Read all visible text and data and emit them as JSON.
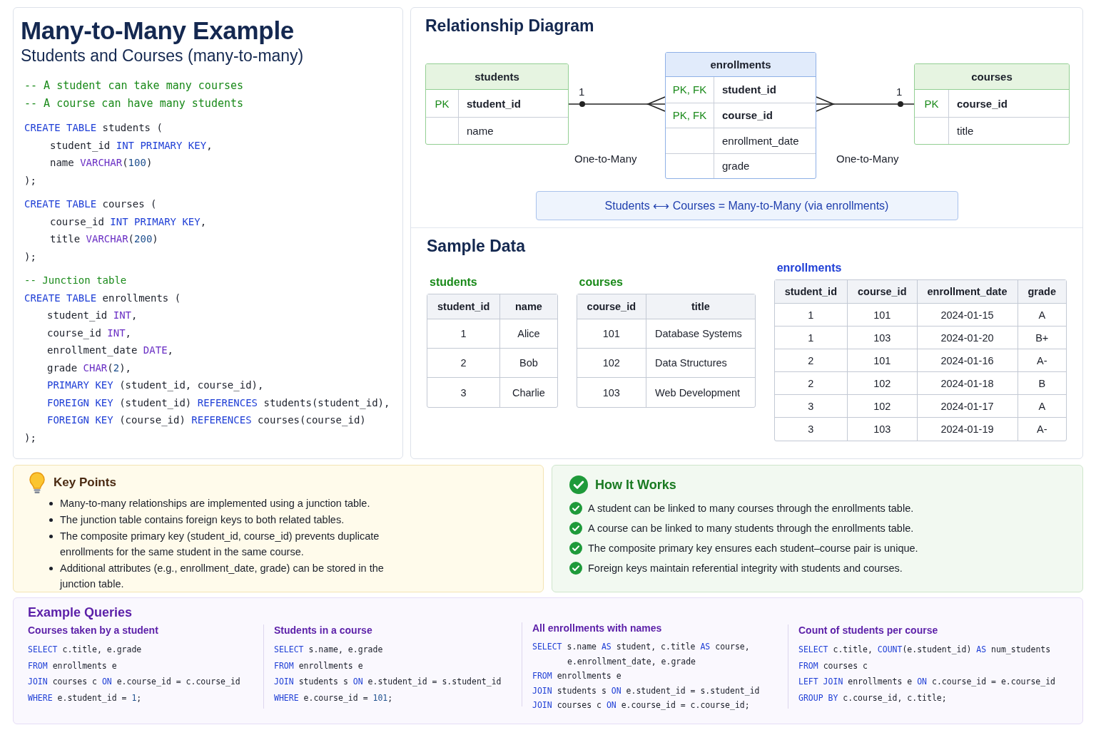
{
  "header": {
    "title": "Many-to-Many Example",
    "subtitle": "Students and Courses (many-to-many)"
  },
  "schema_code": {
    "blocks": [
      [
        {
          "tokens": [
            {
              "kind": "comment",
              "text": "-- A student can take many courses"
            }
          ]
        },
        {
          "tokens": [
            {
              "kind": "comment",
              "text": "-- A course can have many students"
            }
          ]
        }
      ],
      [
        {
          "tokens": [
            {
              "kind": "kw",
              "text": "CREATE TABLE"
            },
            {
              "kind": "plain",
              "text": " students ("
            }
          ]
        },
        {
          "indent": true,
          "tokens": [
            {
              "kind": "plain",
              "text": "student_id "
            },
            {
              "kind": "kw",
              "text": "INT PRIMARY KEY"
            },
            {
              "kind": "plain",
              "text": ","
            }
          ]
        },
        {
          "indent": true,
          "tokens": [
            {
              "kind": "plain",
              "text": "name "
            },
            {
              "kind": "type",
              "text": "VARCHAR"
            },
            {
              "kind": "plain",
              "text": "("
            },
            {
              "kind": "num",
              "text": "100"
            },
            {
              "kind": "plain",
              "text": ")"
            }
          ]
        },
        {
          "tokens": [
            {
              "kind": "plain",
              "text": ");"
            }
          ]
        }
      ],
      [
        {
          "tokens": [
            {
              "kind": "kw",
              "text": "CREATE TABLE"
            },
            {
              "kind": "plain",
              "text": " courses ("
            }
          ]
        },
        {
          "indent": true,
          "tokens": [
            {
              "kind": "plain",
              "text": "course_id "
            },
            {
              "kind": "kw",
              "text": "INT PRIMARY KEY"
            },
            {
              "kind": "plain",
              "text": ","
            }
          ]
        },
        {
          "indent": true,
          "tokens": [
            {
              "kind": "plain",
              "text": "title "
            },
            {
              "kind": "type",
              "text": "VARCHAR"
            },
            {
              "kind": "plain",
              "text": "("
            },
            {
              "kind": "num",
              "text": "200"
            },
            {
              "kind": "plain",
              "text": ")"
            }
          ]
        },
        {
          "tokens": [
            {
              "kind": "plain",
              "text": ");"
            }
          ]
        }
      ],
      [
        {
          "tokens": [
            {
              "kind": "comment",
              "text": "-- Junction table"
            }
          ]
        },
        {
          "tokens": [
            {
              "kind": "kw",
              "text": "CREATE TABLE"
            },
            {
              "kind": "plain",
              "text": " enrollments ("
            }
          ]
        },
        {
          "indent": true,
          "tokens": [
            {
              "kind": "plain",
              "text": "student_id "
            },
            {
              "kind": "type",
              "text": "INT"
            },
            {
              "kind": "plain",
              "text": ","
            }
          ]
        },
        {
          "indent": true,
          "tokens": [
            {
              "kind": "plain",
              "text": "course_id "
            },
            {
              "kind": "type",
              "text": "INT"
            },
            {
              "kind": "plain",
              "text": ","
            }
          ]
        },
        {
          "indent": true,
          "tokens": [
            {
              "kind": "plain",
              "text": "enrollment_date "
            },
            {
              "kind": "type",
              "text": "DATE"
            },
            {
              "kind": "plain",
              "text": ","
            }
          ]
        },
        {
          "indent": true,
          "tokens": [
            {
              "kind": "plain",
              "text": "grade "
            },
            {
              "kind": "type",
              "text": "CHAR"
            },
            {
              "kind": "plain",
              "text": "("
            },
            {
              "kind": "num",
              "text": "2"
            },
            {
              "kind": "plain",
              "text": "),"
            }
          ]
        },
        {
          "indent": true,
          "tokens": [
            {
              "kind": "kw",
              "text": "PRIMARY KEY"
            },
            {
              "kind": "plain",
              "text": " (student_id, course_id),"
            }
          ]
        },
        {
          "indent": true,
          "tokens": [
            {
              "kind": "kw",
              "text": "FOREIGN KEY"
            },
            {
              "kind": "plain",
              "text": " (student_id) "
            },
            {
              "kind": "kw",
              "text": "REFERENCES"
            },
            {
              "kind": "plain",
              "text": " students(student_id),"
            }
          ]
        },
        {
          "indent": true,
          "tokens": [
            {
              "kind": "kw",
              "text": "FOREIGN KEY"
            },
            {
              "kind": "plain",
              "text": " (course_id) "
            },
            {
              "kind": "kw",
              "text": "REFERENCES"
            },
            {
              "kind": "plain",
              "text": " courses(course_id)"
            }
          ]
        },
        {
          "tokens": [
            {
              "kind": "plain",
              "text": ");"
            }
          ]
        }
      ]
    ]
  },
  "diagram": {
    "title": "Relationship Diagram",
    "entities": [
      {
        "name": "students",
        "kind": "entity",
        "columns": [
          {
            "key": "PK",
            "name": "student_id"
          },
          {
            "name": "name"
          }
        ]
      },
      {
        "name": "enrollments",
        "kind": "junction",
        "columns": [
          {
            "key": "PK, FK",
            "name": "student_id"
          },
          {
            "key": "PK, FK",
            "name": "course_id"
          },
          {
            "name": "enrollment_date"
          },
          {
            "name": "grade"
          }
        ]
      },
      {
        "name": "courses",
        "kind": "entity",
        "columns": [
          {
            "key": "PK",
            "name": "course_id"
          },
          {
            "name": "title"
          }
        ]
      }
    ],
    "relationships": [
      {
        "one_label": "1",
        "label": "One-to-Many"
      },
      {
        "one_label": "1",
        "label": "One-to-Many"
      }
    ],
    "summary": "Students ⟷ Courses = Many-to-Many (via enrollments)"
  },
  "sample_data": {
    "title": "Sample Data",
    "tables": [
      {
        "name": "students",
        "color": "#1a8a1a",
        "columns": [
          "student_id",
          "name"
        ],
        "rows": [
          [
            "1",
            "Alice"
          ],
          [
            "2",
            "Bob"
          ],
          [
            "3",
            "Charlie"
          ]
        ]
      },
      {
        "name": "courses",
        "color": "#1a8a1a",
        "columns": [
          "course_id",
          "title"
        ],
        "rows": [
          [
            "101",
            "Database Systems"
          ],
          [
            "102",
            "Data Structures"
          ],
          [
            "103",
            "Web Development"
          ]
        ]
      },
      {
        "name": "enrollments",
        "color": "#1f3fd6",
        "columns": [
          "student_id",
          "course_id",
          "enrollment_date",
          "grade"
        ],
        "rows": [
          [
            "1",
            "101",
            "2024-01-15",
            "A"
          ],
          [
            "1",
            "103",
            "2024-01-20",
            "B+"
          ],
          [
            "2",
            "101",
            "2024-01-16",
            "A-"
          ],
          [
            "2",
            "102",
            "2024-01-18",
            "B"
          ],
          [
            "3",
            "102",
            "2024-01-17",
            "A"
          ],
          [
            "3",
            "103",
            "2024-01-19",
            "A-"
          ]
        ]
      }
    ]
  },
  "key_points": {
    "title": "Key Points",
    "items": [
      "Many-to-many relationships are implemented using a junction table.",
      "The junction table contains foreign keys to both related tables.",
      "The composite primary key (student_id, course_id) prevents duplicate enrollments for the same student in the same course.",
      "Additional attributes (e.g., enrollment_date, grade) can be stored in the junction table."
    ]
  },
  "how_it_works": {
    "title": "How It Works",
    "items": [
      "A student can be linked to many courses through the enrollments table.",
      "A course can be linked to many students through the enrollments table.",
      "The composite primary key ensures each student–course pair is unique.",
      "Foreign keys maintain referential integrity with students and courses."
    ]
  },
  "example_queries": {
    "title": "Example Queries",
    "queries": [
      {
        "title": "Courses taken by a student",
        "lines": [
          {
            "tokens": [
              {
                "kind": "kw",
                "text": "SELECT"
              },
              {
                "kind": "plain",
                "text": " c.title, e.grade"
              }
            ]
          },
          {
            "tokens": [
              {
                "kind": "kw",
                "text": "FROM"
              },
              {
                "kind": "plain",
                "text": " enrollments e"
              }
            ]
          },
          {
            "tokens": [
              {
                "kind": "kw",
                "text": "JOIN"
              },
              {
                "kind": "plain",
                "text": " courses c "
              },
              {
                "kind": "kw",
                "text": "ON"
              },
              {
                "kind": "plain",
                "text": " e.course_id = c.course_id"
              }
            ]
          },
          {
            "tokens": [
              {
                "kind": "kw",
                "text": "WHERE"
              },
              {
                "kind": "plain",
                "text": " e.student_id = "
              },
              {
                "kind": "num",
                "text": "1"
              },
              {
                "kind": "plain",
                "text": ";"
              }
            ]
          }
        ]
      },
      {
        "title": "Students in a course",
        "lines": [
          {
            "tokens": [
              {
                "kind": "kw",
                "text": "SELECT"
              },
              {
                "kind": "plain",
                "text": " s.name, e.grade"
              }
            ]
          },
          {
            "tokens": [
              {
                "kind": "kw",
                "text": "FROM"
              },
              {
                "kind": "plain",
                "text": " enrollments e"
              }
            ]
          },
          {
            "tokens": [
              {
                "kind": "kw",
                "text": "JOIN"
              },
              {
                "kind": "plain",
                "text": " students s "
              },
              {
                "kind": "kw",
                "text": "ON"
              },
              {
                "kind": "plain",
                "text": " e.student_id = s.student_id"
              }
            ]
          },
          {
            "tokens": [
              {
                "kind": "kw",
                "text": "WHERE"
              },
              {
                "kind": "plain",
                "text": " e.course_id = "
              },
              {
                "kind": "num",
                "text": "101"
              },
              {
                "kind": "plain",
                "text": ";"
              }
            ]
          }
        ]
      },
      {
        "title": "All enrollments with names",
        "lines": [
          {
            "tokens": [
              {
                "kind": "kw",
                "text": "SELECT"
              },
              {
                "kind": "plain",
                "text": " s.name "
              },
              {
                "kind": "kw",
                "text": "AS"
              },
              {
                "kind": "plain",
                "text": " student, c.title "
              },
              {
                "kind": "kw",
                "text": "AS"
              },
              {
                "kind": "plain",
                "text": " course,"
              }
            ]
          },
          {
            "indent": true,
            "tokens": [
              {
                "kind": "plain",
                "text": "e.enrollment_date, e.grade"
              }
            ]
          },
          {
            "tokens": [
              {
                "kind": "kw",
                "text": "FROM"
              },
              {
                "kind": "plain",
                "text": " enrollments e"
              }
            ]
          },
          {
            "tokens": [
              {
                "kind": "kw",
                "text": "JOIN"
              },
              {
                "kind": "plain",
                "text": " students s "
              },
              {
                "kind": "kw",
                "text": "ON"
              },
              {
                "kind": "plain",
                "text": " e.student_id = s.student_id"
              }
            ]
          },
          {
            "tokens": [
              {
                "kind": "kw",
                "text": "JOIN"
              },
              {
                "kind": "plain",
                "text": " courses c "
              },
              {
                "kind": "kw",
                "text": "ON"
              },
              {
                "kind": "plain",
                "text": " e.course_id = c.course_id;"
              }
            ]
          }
        ]
      },
      {
        "title": "Count of students per course",
        "lines": [
          {
            "tokens": [
              {
                "kind": "kw",
                "text": "SELECT"
              },
              {
                "kind": "plain",
                "text": " c.title, "
              },
              {
                "kind": "kw",
                "text": "COUNT"
              },
              {
                "kind": "plain",
                "text": "(e.student_id) "
              },
              {
                "kind": "kw",
                "text": "AS"
              },
              {
                "kind": "plain",
                "text": " num_students"
              }
            ]
          },
          {
            "tokens": [
              {
                "kind": "kw",
                "text": "FROM"
              },
              {
                "kind": "plain",
                "text": " courses c"
              }
            ]
          },
          {
            "tokens": [
              {
                "kind": "kw",
                "text": "LEFT JOIN"
              },
              {
                "kind": "plain",
                "text": " enrollments e "
              },
              {
                "kind": "kw",
                "text": "ON"
              },
              {
                "kind": "plain",
                "text": " c.course_id = e.course_id"
              }
            ]
          },
          {
            "tokens": [
              {
                "kind": "kw",
                "text": "GROUP BY"
              },
              {
                "kind": "plain",
                "text": " c.course_id, c.title;"
              }
            ]
          }
        ]
      }
    ]
  }
}
